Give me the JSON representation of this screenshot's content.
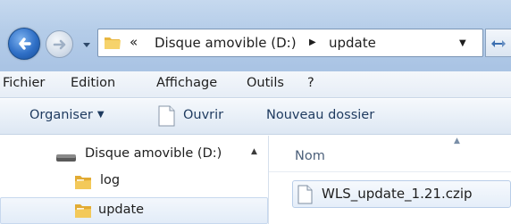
{
  "address_bar": {
    "overflow_chevrons": "«",
    "crumbs": [
      "Disque amovible (D:)",
      "update"
    ],
    "separator_icon": "breadcrumb-arrow-right",
    "dropdown_icon": "triangle-down"
  },
  "menu": {
    "items": [
      "Fichier",
      "Edition",
      "Affichage",
      "Outils",
      "?"
    ]
  },
  "toolbar": {
    "organize_label": "Organiser",
    "open_label": "Ouvrir",
    "new_folder_label": "Nouveau dossier"
  },
  "navigation_pane": {
    "items": [
      {
        "label": "Disque amovible (D:)",
        "icon": "removable-drive-icon",
        "selected": false
      },
      {
        "label": "log",
        "icon": "folder-icon",
        "selected": false
      },
      {
        "label": "update",
        "icon": "folder-icon",
        "selected": true
      }
    ]
  },
  "content": {
    "columns": [
      "Nom"
    ],
    "files": [
      {
        "name": "WLS_update_1.21.czip",
        "icon": "document-icon",
        "selected": true
      }
    ]
  },
  "colors": {
    "title_bar": "#b4cce8",
    "selection": "#e2ecf8",
    "selection_border": "#c7d8ee"
  }
}
